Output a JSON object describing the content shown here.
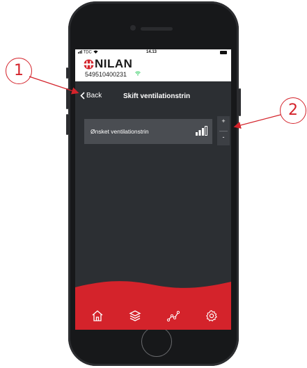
{
  "statusbar": {
    "carrier": "TDC",
    "time": "14.13"
  },
  "brand": {
    "logo_text": "NILAN",
    "serial": "549510400231"
  },
  "navbar": {
    "back_label": "Back",
    "title": "Skift ventilationstrin"
  },
  "setting": {
    "label": "Ønsket ventilationstrin",
    "level": 3,
    "max_level": 4,
    "plus_label": "+",
    "minus_label": "-"
  },
  "footer": {
    "tabs": [
      "home-icon",
      "layers-icon",
      "graph-icon",
      "gear-icon"
    ]
  },
  "callouts": {
    "one": "1",
    "two": "2"
  },
  "colors": {
    "accent": "#d4232b",
    "screen_bg": "#2c2f33",
    "row_bg": "#4a4d52",
    "wifi": "#3ccf6a"
  }
}
